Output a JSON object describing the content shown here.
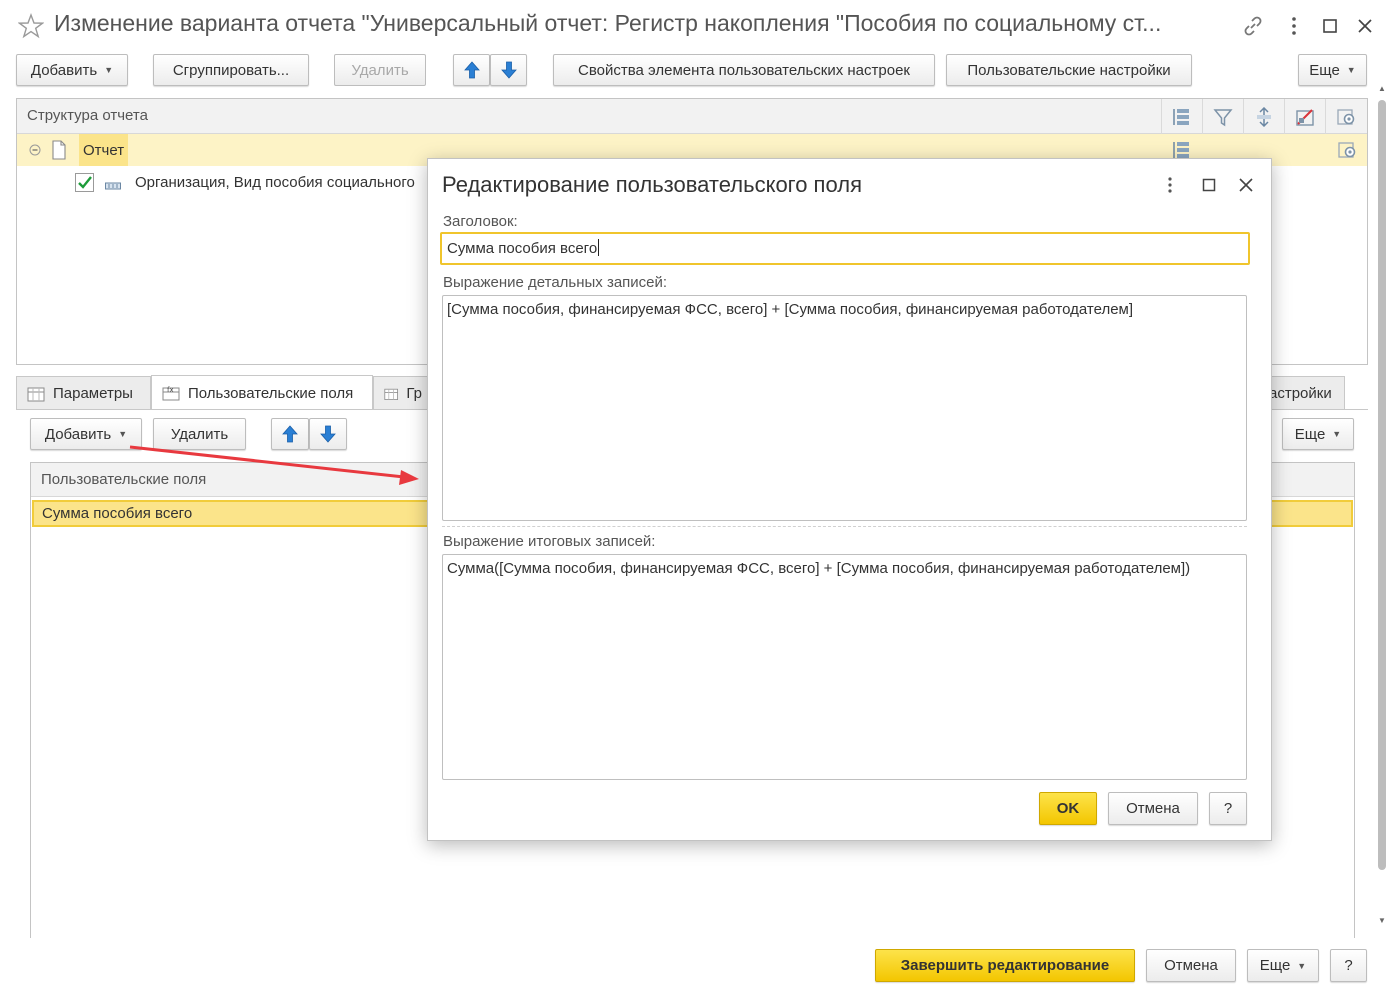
{
  "window": {
    "title": "Изменение варианта отчета \"Универсальный отчет: Регистр накопления \"Пособия по социальному ст..."
  },
  "toolbar": {
    "add_label": "Добавить",
    "group_label": "Сгруппировать...",
    "delete_label": "Удалить",
    "element_props_label": "Свойства элемента пользовательских настроек",
    "user_settings_label": "Пользовательские настройки",
    "more_label": "Еще"
  },
  "structure": {
    "header": "Структура отчета",
    "rows": [
      {
        "label": "Отчет"
      },
      {
        "label": "Организация, Вид пособия социального"
      }
    ]
  },
  "tabs": [
    {
      "label": "Параметры"
    },
    {
      "label": "Пользовательские поля"
    },
    {
      "label": "Гр"
    },
    {
      "label": "астройки"
    }
  ],
  "lower": {
    "add_label": "Добавить",
    "delete_label": "Удалить",
    "more_label": "Еще",
    "column_header": "Пользовательские поля",
    "rows": [
      "Сумма пособия всего"
    ]
  },
  "dialog": {
    "title": "Редактирование пользовательского поля",
    "caption_label": "Заголовок:",
    "caption_value": "Сумма пособия всего",
    "detail_label": "Выражение детальных записей:",
    "detail_value": "[Сумма пособия, финансируемая ФСС, всего] + [Сумма пособия, финансируемая работодателем]",
    "total_label": "Выражение итоговых записей:",
    "total_value": "Сумма([Сумма пособия, финансируемая ФСС, всего] + [Сумма пособия, финансируемая работодателем])",
    "ok_label": "OK",
    "cancel_label": "Отмена",
    "help_label": "?"
  },
  "footer": {
    "finish_label": "Завершить редактирование",
    "cancel_label": "Отмена",
    "more_label": "Еще",
    "help_label": "?"
  },
  "colors": {
    "selection": "#fbeca0",
    "selection_border": "#f1cc3a",
    "accent_yellow": "#f5c800",
    "arrow_blue": "#2a7fd4",
    "annotation_red": "#e8393f"
  }
}
